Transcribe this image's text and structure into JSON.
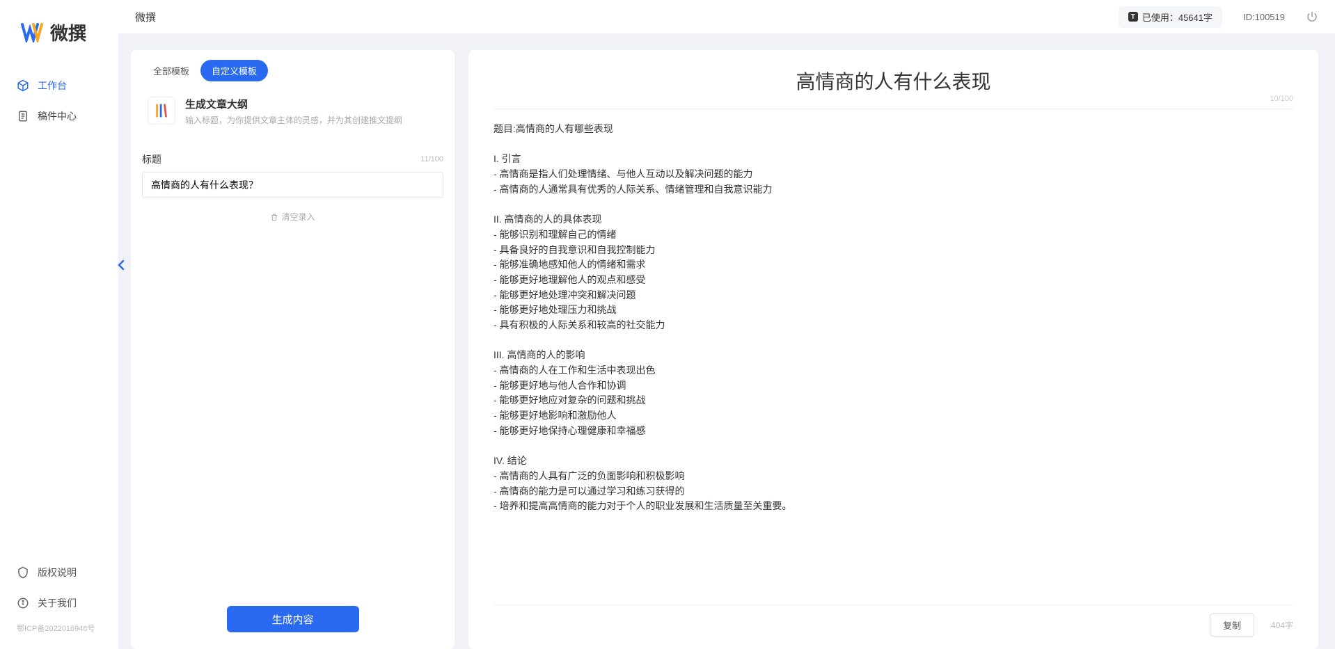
{
  "brand": "微撰",
  "topbar": {
    "title": "微撰",
    "usage_label": "已使用：45641字",
    "user_id": "ID:100519"
  },
  "sidebar": {
    "items": [
      {
        "label": "工作台",
        "active": true
      },
      {
        "label": "稿件中心",
        "active": false
      }
    ],
    "bottom": [
      {
        "label": "版权说明"
      },
      {
        "label": "关于我们"
      }
    ],
    "icp": "鄂ICP备2022016946号"
  },
  "left_panel": {
    "tabs": {
      "all": "全部模板",
      "custom": "自定义模板"
    },
    "template": {
      "title": "生成文章大纲",
      "desc": "输入标题，为你提供文章主体的灵感，并为其创建推文提纲"
    },
    "form": {
      "label": "标题",
      "counter": "11/100",
      "value": "高情商的人有什么表现？",
      "clear": "清空录入"
    },
    "generate_btn": "生成内容"
  },
  "right_panel": {
    "title": "高情商的人有什么表现",
    "title_counter": "10/100",
    "body": "题目:高情商的人有哪些表现\n\nI. 引言\n- 高情商是指人们处理情绪、与他人互动以及解决问题的能力\n- 高情商的人通常具有优秀的人际关系、情绪管理和自我意识能力\n\nII. 高情商的人的具体表现\n- 能够识别和理解自己的情绪\n- 具备良好的自我意识和自我控制能力\n- 能够准确地感知他人的情绪和需求\n- 能够更好地理解他人的观点和感受\n- 能够更好地处理冲突和解决问题\n- 能够更好地处理压力和挑战\n- 具有积极的人际关系和较高的社交能力\n\nIII. 高情商的人的影响\n- 高情商的人在工作和生活中表现出色\n- 能够更好地与他人合作和协调\n- 能够更好地应对复杂的问题和挑战\n- 能够更好地影响和激励他人\n- 能够更好地保持心理健康和幸福感\n\nIV. 结论\n- 高情商的人具有广泛的负面影响和积极影响\n- 高情商的能力是可以通过学习和练习获得的\n- 培养和提高高情商的能力对于个人的职业发展和生活质量至关重要。",
    "copy": "复制",
    "char_count": "404字"
  }
}
